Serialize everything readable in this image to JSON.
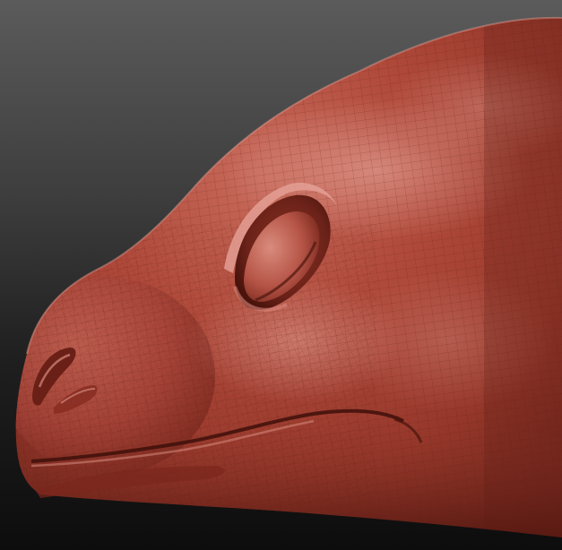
{
  "scene": {
    "subject": "sculpted-creature-head",
    "material": "red-clay",
    "colors": {
      "clay_base": "#a03a2c",
      "clay_highlight": "#d9897c",
      "clay_shadow": "#5a1a12",
      "wire": "#6e2419",
      "background_top": "#5b5b5b",
      "background_bottom": "#0d0d0d"
    }
  }
}
